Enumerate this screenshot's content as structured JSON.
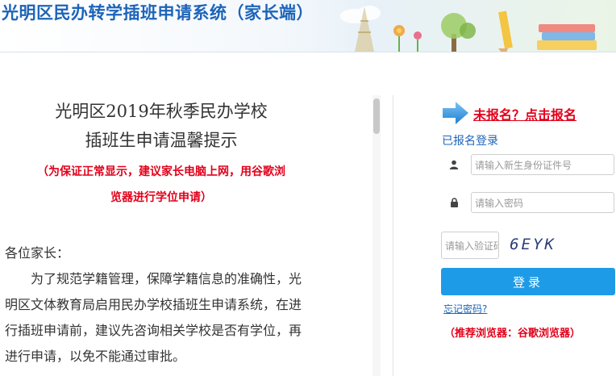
{
  "header": {
    "title": "光明区民办转学插班申请系统（家长端）"
  },
  "notice": {
    "title_line1": "光明区2019年秋季民办学校",
    "title_line2": "插班生申请温馨提示",
    "warning_line1": "（为保证正常显示，建议家长电脑上网，用谷歌浏",
    "warning_line2": "览器进行学位申请）",
    "greeting": "各位家长：",
    "paragraph": "为了规范学籍管理，保障学籍信息的准确性，光明区文体教育局启用民办学校插班生申请系统，在进行插班申请前，建议先咨询相关学校是否有学位，再进行申请，以免不能通过审批。"
  },
  "login": {
    "register_link": "未报名？点击报名",
    "registered_link": "已报名登录",
    "id_placeholder": "请输入新生身份证件号",
    "password_placeholder": "请输入密码",
    "captcha_placeholder": "请输入验证码",
    "captcha_code": "6EYK",
    "login_button": "登录",
    "forgot_password": "忘记密码?",
    "browser_tip": "（推荐浏览器：谷歌浏览器）"
  },
  "colors": {
    "brand_blue": "#1d64b9",
    "alert_red": "#e2001a",
    "button_blue": "#1e9be6"
  },
  "icons": {
    "user_field": "user-icon",
    "password_field": "lock-icon",
    "register_pointer": "arrow-right-icon"
  }
}
